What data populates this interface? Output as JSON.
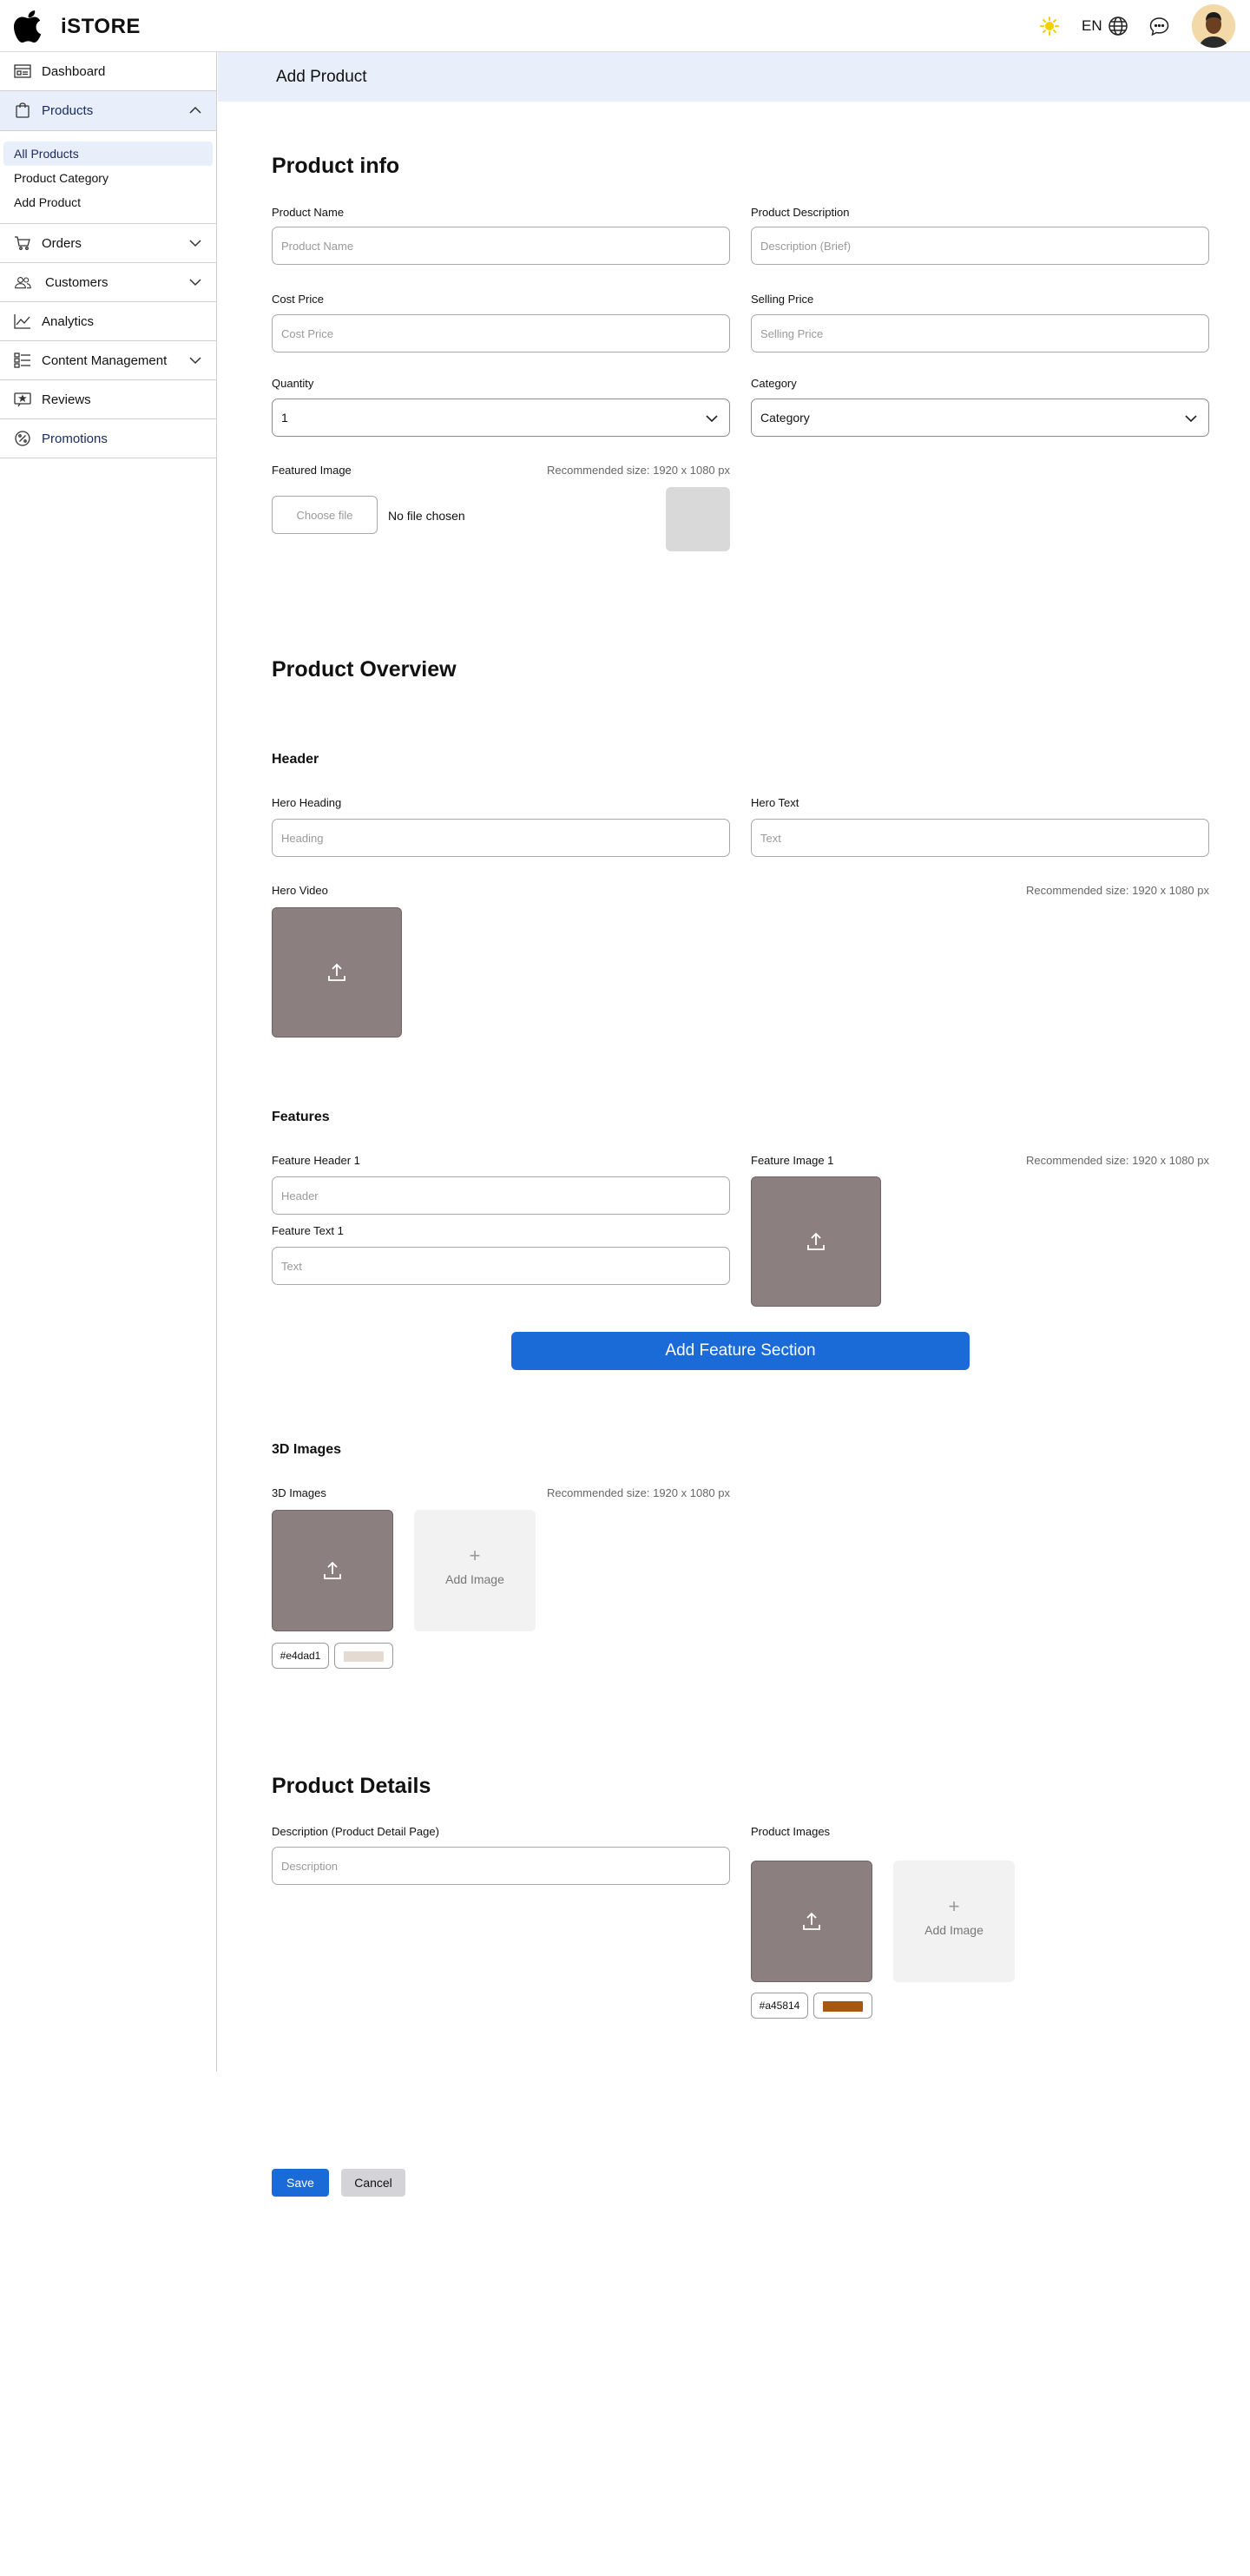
{
  "app": {
    "brand": "iSTORE",
    "language": "EN"
  },
  "icons": {
    "logo": "apple-logo-icon",
    "theme": "sun-icon",
    "language": "globe-icon",
    "messages": "chat-bubble-icon",
    "user": "user-avatar"
  },
  "colors": {
    "accent": "#1a6ad8",
    "sun": "#f5d000",
    "active_bg": "#e8eefa"
  },
  "sidebar": {
    "items": [
      {
        "label": "Dashboard",
        "icon": "dashboard-icon"
      },
      {
        "label": "Products",
        "icon": "shopping-bag-icon",
        "expanded": true
      },
      {
        "label": "Orders",
        "icon": "cart-icon"
      },
      {
        "label": "Customers",
        "icon": "users-icon"
      },
      {
        "label": "Analytics",
        "icon": "chart-line-icon"
      },
      {
        "label": "Content Management",
        "icon": "list-icon"
      },
      {
        "label": "Reviews",
        "icon": "review-icon"
      },
      {
        "label": "Promotions",
        "icon": "percent-badge-icon"
      }
    ],
    "products_sub": [
      "All Products",
      "Product Category",
      "Add Product"
    ]
  },
  "page": {
    "title": "Add Product"
  },
  "product_info": {
    "heading": "Product info",
    "product_name_label": "Product Name",
    "product_name_placeholder": "Product Name",
    "product_description_label": "Product Description",
    "product_description_placeholder": "Description (Brief)",
    "cost_price_label": "Cost Price",
    "cost_price_placeholder": "Cost Price",
    "selling_price_label": "Selling Price",
    "selling_price_placeholder": "Selling Price",
    "quantity_label": "Quantity",
    "quantity_value": "1",
    "category_label": "Category",
    "category_value": "Category",
    "featured_image_label": "Featured Image",
    "recommended": "Recommended size: 1920 x 1080 px",
    "choose_file": "Choose file",
    "no_file": "No file chosen"
  },
  "overview": {
    "heading": "Product Overview",
    "header_heading": "Header",
    "hero_heading_label": "Hero Heading",
    "hero_heading_placeholder": "Heading",
    "hero_text_label": "Hero Text",
    "hero_text_placeholder": "Text",
    "hero_video_label": "Hero Video",
    "recommended": "Recommended size: 1920 x 1080 px"
  },
  "features": {
    "heading": "Features",
    "feature_header_label": "Feature Header 1",
    "feature_header_placeholder": "Header",
    "feature_text_label": "Feature Text 1",
    "feature_text_placeholder": "Text",
    "feature_image_label": "Feature Image 1",
    "recommended": "Recommended size: 1920 x 1080 px",
    "add_button": "Add Feature Section"
  },
  "images_3d": {
    "heading": "3D Images",
    "label": "3D Images",
    "recommended": "Recommended size: 1920 x 1080 px",
    "add_image": "Add Image",
    "plus": "+",
    "color_hex": "#e4dad1",
    "color": "#e4dad1"
  },
  "details": {
    "heading": "Product Details",
    "description_label": "Description (Product Detail Page)",
    "description_placeholder": "Description",
    "images_label": "Product Images",
    "add_image": "Add Image",
    "plus": "+",
    "color_hex": "#a45814",
    "color": "#a45814"
  },
  "actions": {
    "save": "Save",
    "cancel": "Cancel"
  }
}
